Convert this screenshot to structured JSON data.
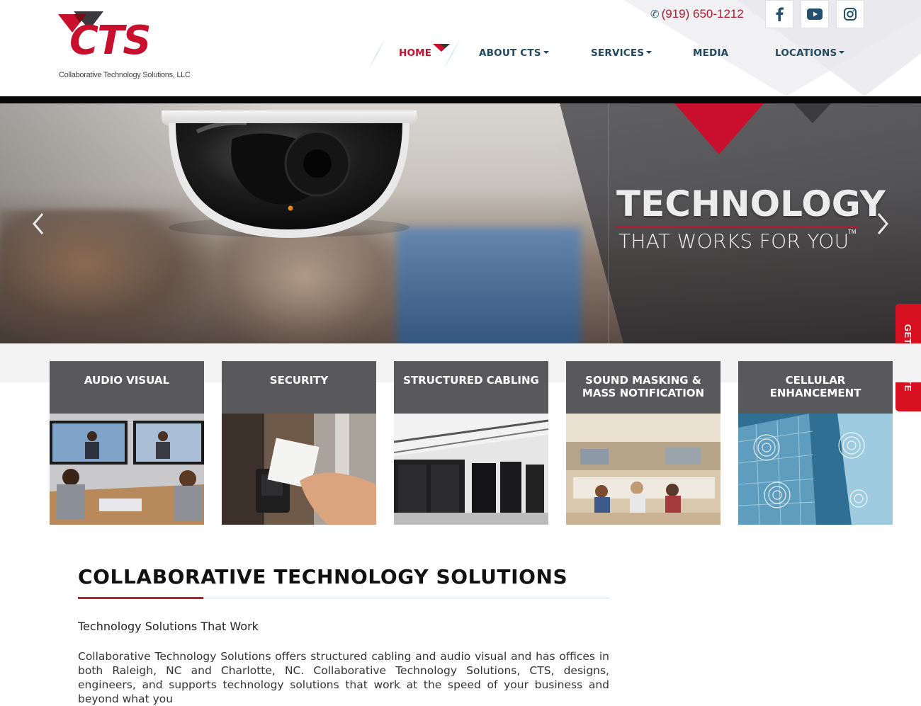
{
  "logo": {
    "text": "CTS",
    "subtitle": "Collaborative Technology Solutions, LLC"
  },
  "contact": {
    "phone": "(919) 650-1212"
  },
  "social": [
    {
      "name": "facebook",
      "icon": "facebook-icon"
    },
    {
      "name": "youtube",
      "icon": "youtube-icon"
    },
    {
      "name": "instagram",
      "icon": "instagram-icon"
    }
  ],
  "nav": {
    "home": "HOME",
    "about": "ABOUT CTS",
    "services": "SERVICES",
    "media": "MEDIA",
    "locations": "LOCATIONS"
  },
  "hero": {
    "headline": "TECHNOLOGY",
    "tagline": "THAT WORKS FOR YOU",
    "trademark": "TM",
    "prev_icon": "chevron-left-icon",
    "next_icon": "chevron-right-icon"
  },
  "quote_tab": "GET A QUOTE",
  "services": [
    {
      "line1": "AUDIO VISUAL",
      "line2": ""
    },
    {
      "line1": "SECURITY",
      "line2": ""
    },
    {
      "line1": "STRUCTURED CABLING",
      "line2": ""
    },
    {
      "line1": "SOUND MASKING &",
      "line2": "MASS NOTIFICATION"
    },
    {
      "line1": "CELLULAR",
      "line2": "ENHANCEMENT"
    }
  ],
  "content": {
    "title": "COLLABORATIVE TECHNOLOGY SOLUTIONS",
    "subtitle": "Technology Solutions That Work",
    "paragraph": "Collaborative Technology Solutions offers structured cabling and audio visual and has offices in both Raleigh, NC and Charlotte, NC. Collaborative Technology Solutions, CTS, designs, engineers, and supports technology solutions that work at the speed of your business and beyond what you"
  },
  "colors": {
    "brand_red": "#c8102e",
    "nav_blue": "#20485f",
    "card_gray": "#59595c"
  }
}
